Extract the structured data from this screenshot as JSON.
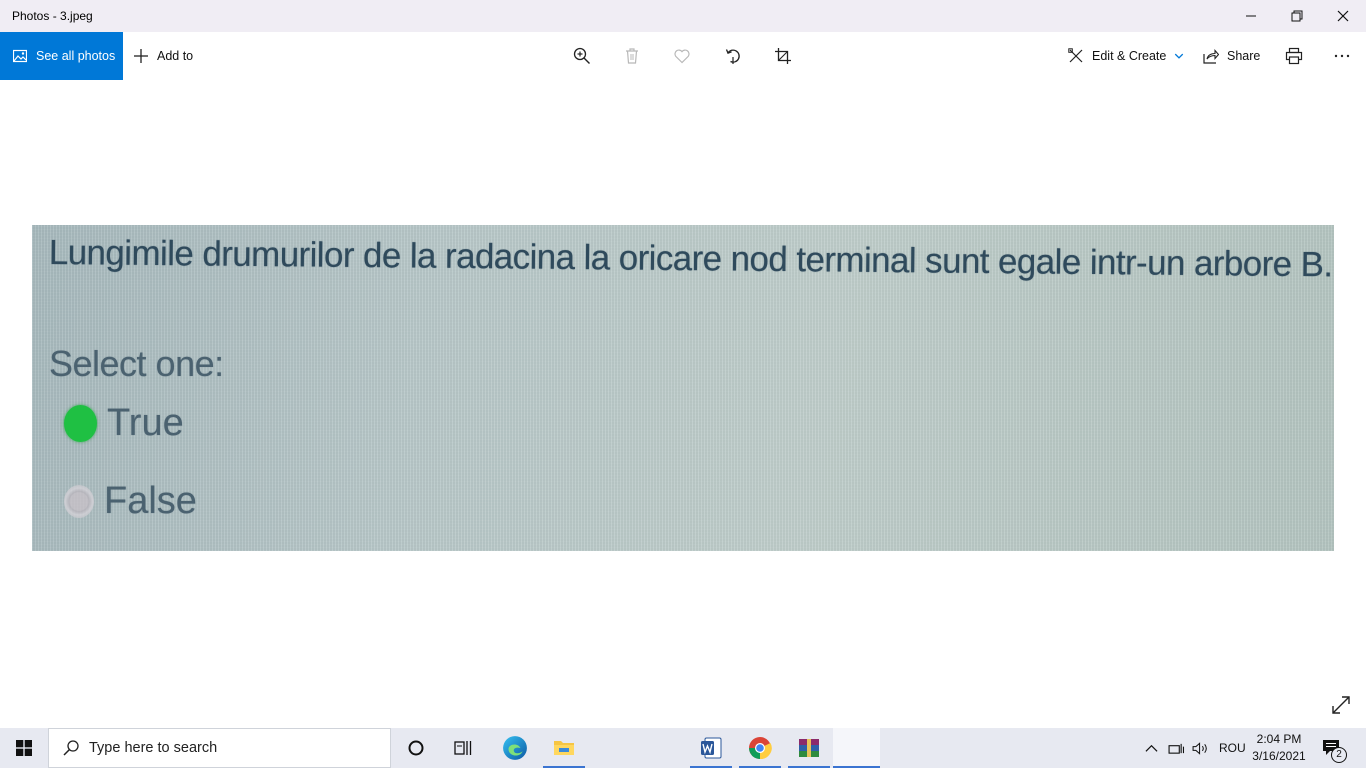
{
  "window": {
    "title": "Photos - 3.jpeg"
  },
  "toolbar": {
    "see_all_photos": "See all photos",
    "add_to": "Add to",
    "edit_create": "Edit & Create",
    "share": "Share"
  },
  "photo": {
    "question": "Lungimile drumurilor de la radacina la oricare nod terminal sunt egale intr-un arbore B.",
    "select_one": "Select one:",
    "options": [
      {
        "label": "True",
        "selected": true
      },
      {
        "label": "False",
        "selected": false
      }
    ]
  },
  "taskbar": {
    "search_placeholder": "Type here to search",
    "language": "ROU",
    "time": "2:04 PM",
    "date": "3/16/2021",
    "notifications_count": "2"
  },
  "colors": {
    "accent": "#0078d7",
    "selected_radio": "#1fc043",
    "photo_text": "#2f4a5c"
  }
}
